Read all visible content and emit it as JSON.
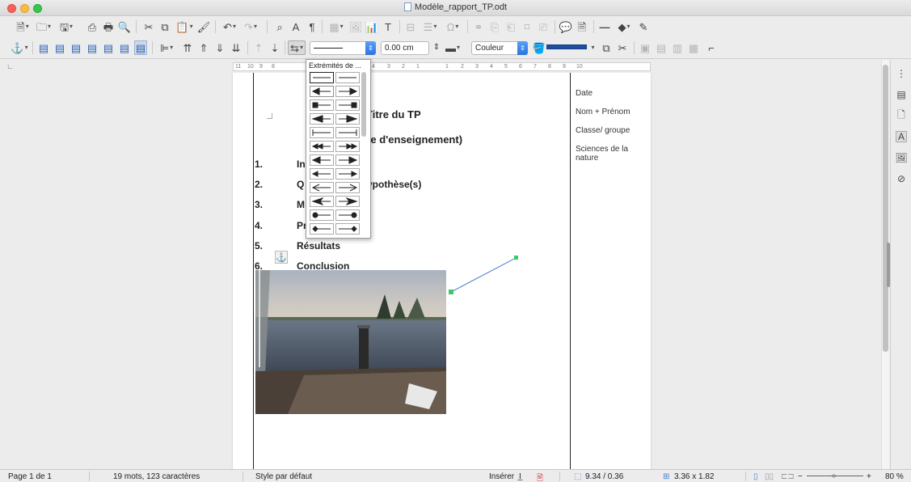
{
  "window": {
    "title": "Modèle_rapport_TP.odt"
  },
  "line_style": {
    "width_value": "0.00 cm",
    "color_label": "Couleur",
    "line_color": "#1c4ea0"
  },
  "arrow_popup": {
    "title": "Extrémités de ..."
  },
  "ruler": {
    "ticks": [
      "11",
      "10",
      "9",
      "8",
      "4",
      "3",
      "2",
      "1",
      "1",
      "2",
      "3",
      "4",
      "5",
      "6",
      "7",
      "8",
      "9",
      "10"
    ]
  },
  "document": {
    "title": "Titre du TP",
    "subtitle": "ence d'enseignement)",
    "items": [
      {
        "num": "1.",
        "label": "In"
      },
      {
        "num": "2.",
        "label": "Q"
      },
      {
        "num": "3.",
        "label": "M"
      },
      {
        "num": "4.",
        "label": "Pr"
      },
      {
        "num": "5.",
        "label": "Résultats"
      },
      {
        "num": "6.",
        "label": "Conclusion"
      }
    ],
    "item2_suffix": "ypothèse(s)",
    "side_column": {
      "date": "Date",
      "name": "Nom + Prénom",
      "class_group": "Classe/ groupe",
      "subject": "Sciences de la nature"
    }
  },
  "statusbar": {
    "page": "Page 1 de 1",
    "word_count": "19 mots, 123 caractères",
    "page_style": "Style par défaut",
    "insert_mode": "Insérer",
    "position": "9.34 / 0.36",
    "size": "3.36 x 1.82",
    "zoom": "80 %"
  },
  "colors": {
    "accent": "#2a74e0",
    "connector_handle": "#3cc96a",
    "connector_line": "#4a7fd6"
  }
}
